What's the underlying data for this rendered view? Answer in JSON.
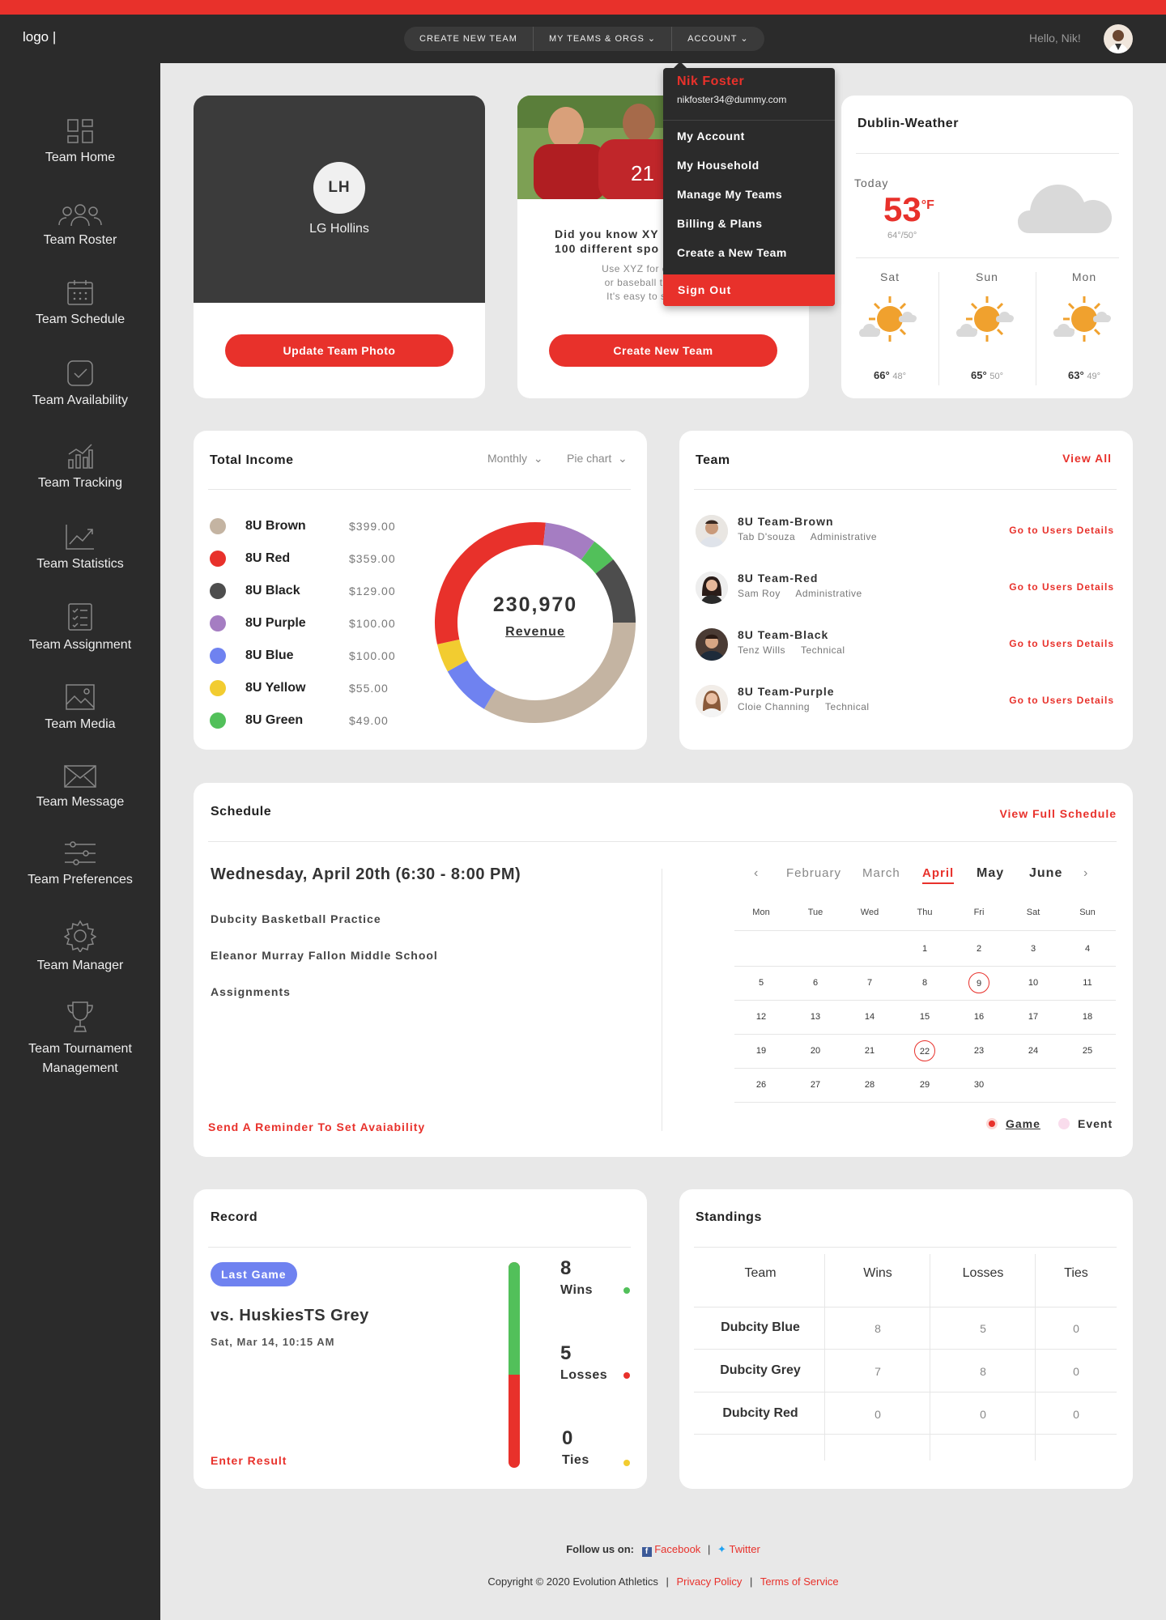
{
  "brand": {
    "logo": "logo |",
    "accent": "#e8312b"
  },
  "nav": {
    "create_team": "CREATE NEW TEAM",
    "my_teams": "MY TEAMS & ORGS",
    "account": "ACCOUNT",
    "hello": "Hello, Nik!"
  },
  "dropdown": {
    "name": "Nik Foster",
    "email": "nikfoster34@dummy.com",
    "items": [
      "My Account",
      "My Household",
      "Manage My Teams",
      "Billing & Plans",
      "Create a New Team"
    ],
    "signout": "Sign Out"
  },
  "sidebar": {
    "items": [
      {
        "label": "Team Home",
        "icon": "dashboard-icon"
      },
      {
        "label": "Team Roster",
        "icon": "users-icon"
      },
      {
        "label": "Team Schedule",
        "icon": "calendar-icon"
      },
      {
        "label": "Team Availability",
        "icon": "check-icon"
      },
      {
        "label": "Team Tracking",
        "icon": "bar-chart-icon"
      },
      {
        "label": "Team Statistics",
        "icon": "trend-icon"
      },
      {
        "label": "Team Assignment",
        "icon": "checklist-icon"
      },
      {
        "label": "Team Media",
        "icon": "image-icon"
      },
      {
        "label": "Team Message",
        "icon": "envelope-icon"
      },
      {
        "label": "Team Preferences",
        "icon": "sliders-icon"
      },
      {
        "label": "Team Manager",
        "icon": "gear-icon"
      },
      {
        "label": "Team Tournament",
        "label2": "Management",
        "icon": "trophy-icon"
      }
    ]
  },
  "profile_card": {
    "initials": "LH",
    "name": "LG Hollins",
    "button": "Update Team Photo"
  },
  "promo_card": {
    "title1": "Did you know XY",
    "title2": "100 different spo",
    "text1": "Use XYZ for everythin",
    "text2": "or baseball to scouts,",
    "text3": "It's easy to start a ne",
    "button": "Create New Team"
  },
  "weather": {
    "title": "Dublin-Weather",
    "today_label": "Today",
    "temp": "53",
    "unit": "°F",
    "range": "64°/50°",
    "days": [
      {
        "day": "Sat",
        "high": "66°",
        "low": "48°"
      },
      {
        "day": "Sun",
        "high": "65°",
        "low": "50°"
      },
      {
        "day": "Mon",
        "high": "63°",
        "low": "49°"
      }
    ]
  },
  "income": {
    "title": "Total Income",
    "filter1": "Monthly",
    "filter2": "Pie chart",
    "total": "230,970",
    "total_label": "Revenue",
    "items": [
      {
        "name": "8U Brown",
        "value": "$399.00",
        "color": "#c4b4a2"
      },
      {
        "name": "8U Red",
        "value": "$359.00",
        "color": "#e8312b"
      },
      {
        "name": "8U Black",
        "value": "$129.00",
        "color": "#4d4d4d"
      },
      {
        "name": "8U Purple",
        "value": "$100.00",
        "color": "#a57dc2"
      },
      {
        "name": "8U Blue",
        "value": "$100.00",
        "color": "#6f82f0"
      },
      {
        "name": "8U Yellow",
        "value": "$55.00",
        "color": "#f2cc30"
      },
      {
        "name": "8U Green",
        "value": "$49.00",
        "color": "#52c05a"
      }
    ]
  },
  "chart_data": {
    "type": "pie",
    "categories": [
      "8U Brown",
      "8U Red",
      "8U Black",
      "8U Purple",
      "8U Blue",
      "8U Yellow",
      "8U Green"
    ],
    "values": [
      399,
      359,
      129,
      100,
      100,
      55,
      49
    ]
  },
  "team": {
    "title": "Team",
    "view_all": "View All",
    "members": [
      {
        "team": "8U Team-Brown",
        "person": "Tab D'souza",
        "role": "Administrative",
        "link": "Go to Users Details"
      },
      {
        "team": "8U Team-Red",
        "person": "Sam Roy",
        "role": "Administrative",
        "link": "Go to Users Details"
      },
      {
        "team": "8U Team-Black",
        "person": "Tenz Wills",
        "role": "Technical",
        "link": "Go to Users Details"
      },
      {
        "team": "8U Team-Purple",
        "person": "Cloie Channing",
        "role": "Technical",
        "link": "Go to Users Details"
      }
    ]
  },
  "schedule": {
    "title": "Schedule",
    "view_full": "View Full Schedule",
    "date": "Wednesday, April 20th (6:30 - 8:00 PM)",
    "event": "Dubcity Basketball Practice",
    "location": "Eleanor Murray Fallon Middle School",
    "assignments": "Assignments",
    "reminder": "Send A Reminder To Set Avaiability",
    "months": [
      "February",
      "March",
      "April",
      "May",
      "June"
    ],
    "weekdays": [
      "Mon",
      "Tue",
      "Wed",
      "Thu",
      "Fri",
      "Sat",
      "Sun"
    ],
    "weeks": [
      [
        "",
        "",
        "",
        "1",
        "2",
        "3",
        "4"
      ],
      [
        "5",
        "6",
        "7",
        "8",
        "9",
        "10",
        "11"
      ],
      [
        "12",
        "13",
        "14",
        "15",
        "16",
        "17",
        "18"
      ],
      [
        "19",
        "20",
        "21",
        "22",
        "23",
        "24",
        "25"
      ],
      [
        "26",
        "27",
        "28",
        "29",
        "30",
        "",
        ""
      ]
    ],
    "legend_game": "Game",
    "legend_event": "Event"
  },
  "record": {
    "title": "Record",
    "badge": "Last Game",
    "opponent": "vs. HuskiesTS Grey",
    "when": "Sat, Mar 14, 10:15 AM",
    "enter": "Enter Result",
    "wins": "8",
    "wins_label": "Wins",
    "losses": "5",
    "losses_label": "Losses",
    "ties": "0",
    "ties_label": "Ties"
  },
  "standings": {
    "title": "Standings",
    "headers": [
      "Team",
      "Wins",
      "Losses",
      "Ties"
    ],
    "rows": [
      [
        "Dubcity  Blue",
        "8",
        "5",
        "0"
      ],
      [
        "Dubcity Grey",
        "7",
        "8",
        "0"
      ],
      [
        "Dubcity  Red",
        "0",
        "0",
        "0"
      ]
    ]
  },
  "footer": {
    "follow": "Follow us on:",
    "facebook": "Facebook",
    "twitter": "Twitter",
    "sep": "|",
    "copyright": "Copyright © 2020 Evolution Athletics",
    "privacy": "Privacy Policy",
    "terms": "Terms of Service"
  }
}
